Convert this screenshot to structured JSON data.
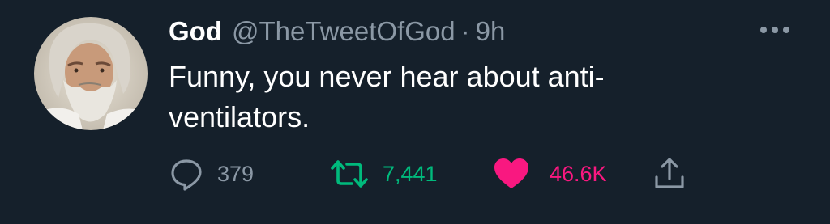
{
  "tweet": {
    "display_name": "God",
    "handle": "@TheTweetOfGod",
    "separator": "·",
    "time": "9h",
    "text": "Funny, you never hear about anti-ventilators.",
    "avatar_icon": "bearded-man-avatar",
    "more_icon": "more-horizontal-icon"
  },
  "actions": {
    "reply": {
      "icon": "reply-icon",
      "count": "379",
      "color": "#8b98a5"
    },
    "retweet": {
      "icon": "retweet-icon",
      "count": "7,441",
      "color": "#00ba7c"
    },
    "like": {
      "icon": "heart-filled-icon",
      "count": "46.6K",
      "color": "#f91880"
    },
    "share": {
      "icon": "share-icon"
    }
  },
  "colors": {
    "background": "#15202b",
    "primary_text": "#ffffff",
    "secondary_text": "#8b98a5"
  }
}
